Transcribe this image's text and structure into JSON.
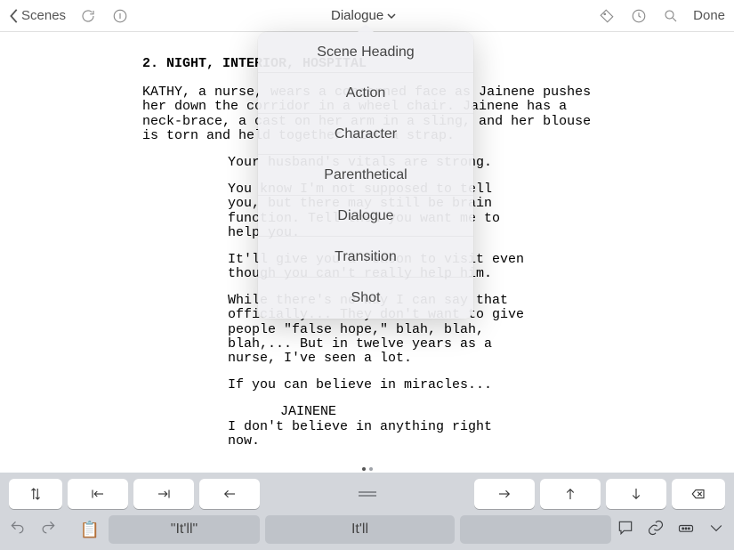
{
  "topbar": {
    "back_label": "Scenes",
    "title": "Dialogue",
    "done_label": "Done"
  },
  "dropdown": {
    "items": [
      "Scene Heading",
      "Action",
      "Character",
      "Parenthetical",
      "Dialogue",
      "Transition",
      "Shot"
    ]
  },
  "screenplay": {
    "slug": "2. NIGHT, INTERIOR, HOSPITAL",
    "action": "KATHY, a nurse, wears a concerned face as Jainene pushes her down the corridor in a wheel chair. Jainene has a neck-brace, a cast on her arm in a sling, and her blouse is torn and held together with a strap.",
    "d1": "Your husband's vitals are strong.",
    "d2": "You know I'm not supposed to tell you, but there may still be brain function. Tell them you want me to help you.",
    "d3": "It'll give you a reason to visit even though you can't really help him.",
    "d4": "While there's no way I can say that officially... They don't want to give people \"false hope,\" blah, blah, blah,... But in twelve years as a nurse, I've seen a lot.",
    "d5": "If you can believe in miracles...",
    "char": "JAINENE",
    "d6": "I don't believe in anything right now."
  },
  "predictions": {
    "p1": "\"It'll\"",
    "p2": "It'll"
  }
}
